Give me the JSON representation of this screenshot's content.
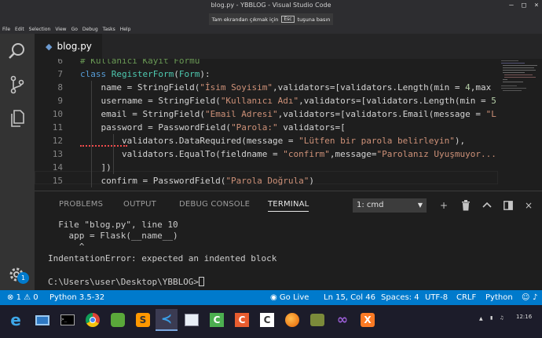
{
  "window": {
    "title": "blog.py - YBBLOG - Visual Studio Code",
    "fullscreen_notice": "Tam ekrandan çıkmak için",
    "fullscreen_key": "Esc",
    "fullscreen_suffix": "tuşuna basın"
  },
  "menu": [
    "File",
    "Edit",
    "Selection",
    "View",
    "Go",
    "Debug",
    "Tasks",
    "Help"
  ],
  "activity": [
    "search-icon",
    "source-control-icon",
    "explorer-icon",
    "gear-icon"
  ],
  "settings_badge": "1",
  "tab": {
    "name": "blog.py",
    "icon": "python-file-icon"
  },
  "editor": {
    "lines": [
      {
        "num": "6",
        "code": "# Kullanıcı Kayıt Formu"
      },
      {
        "num": "7",
        "code": "class RegisterForm(Form):"
      },
      {
        "num": "8",
        "code": "    name = StringField(\"İsim Soyisim\",validators=[validators.Length(min = 4,max"
      },
      {
        "num": "9",
        "code": "    username = StringField(\"Kullanıcı Adı\",validators=[validators.Length(min = 5"
      },
      {
        "num": "10",
        "code": "    email = StringField(\"Email Adresi\",validators=[validators.Email(message = \"L"
      },
      {
        "num": "11",
        "code": "    password = PasswordField(\"Parola:\" validators=["
      },
      {
        "num": "12",
        "code": "        validators.DataRequired(message = \"Lütfen bir parola belirleyin\"),"
      },
      {
        "num": "13",
        "code": "        validators.EqualTo(fieldname = \"confirm\",message=\"Parolanız Uyuşmuyor..."
      },
      {
        "num": "14",
        "code": "    ])"
      },
      {
        "num": "15",
        "code": "    confirm = PasswordField(\"Parola Doğrula\")"
      }
    ]
  },
  "panel": {
    "tabs": [
      "PROBLEMS",
      "OUTPUT",
      "DEBUG CONSOLE",
      "TERMINAL"
    ],
    "active_tab": "TERMINAL",
    "terminal_select": "1: cmd",
    "terminal_lines": [
      "  File \"blog.py\", line 10",
      "    app = Flask(__name__)",
      "      ^",
      "IndentationError: expected an indented block",
      "",
      "C:\\Users\\user\\Desktop\\YBBLOG>"
    ]
  },
  "status": {
    "errors": "1",
    "warnings": "0",
    "interpreter": "Python 3.5-32",
    "go_live": "Go Live",
    "position": "Ln 15, Col 46",
    "spaces": "Spaces: 4",
    "encoding": "UTF-8",
    "eol": "CRLF",
    "language": "Python"
  },
  "taskbar": {
    "apps": [
      "internet-explorer-icon",
      "this-pc-icon",
      "cmd-icon",
      "chrome-icon",
      "camtasia-icon",
      "sublime-text-icon",
      "vscode-icon",
      "paint-icon",
      "camtasia-green-icon",
      "scratch-icon",
      "codeblocks-icon",
      "firefox-icon",
      "game-icon",
      "visual-studio-icon",
      "xampp-icon"
    ],
    "clock_time": "12:16"
  },
  "colors": {
    "accent": "#007acc",
    "keyword": "#569cd6",
    "string": "#ce9178",
    "comment": "#6a9955",
    "class_name": "#4ec9b0"
  }
}
